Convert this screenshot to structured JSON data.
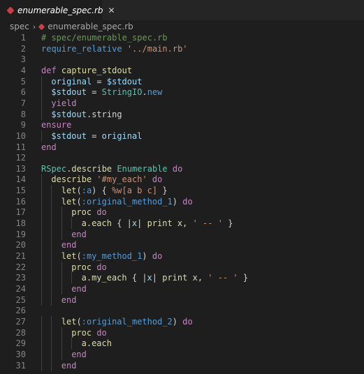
{
  "tab": {
    "label": "enumerable_spec.rb",
    "close": "✕"
  },
  "breadcrumb": {
    "folder": "spec",
    "separator": "›",
    "file": "enumerable_spec.rb"
  },
  "colors": {
    "background": "#1e1e1e",
    "ruby_icon": "#cc3e44"
  },
  "lines": [
    {
      "n": "1",
      "indent": 0,
      "tokens": [
        {
          "t": "# spec/enumerable_spec.rb",
          "c": "comment"
        }
      ]
    },
    {
      "n": "2",
      "indent": 0,
      "tokens": [
        {
          "t": "require_relative",
          "c": "sym"
        },
        {
          "t": " ",
          "c": "default"
        },
        {
          "t": "'../main.rb'",
          "c": "str"
        }
      ]
    },
    {
      "n": "3",
      "indent": 0,
      "tokens": []
    },
    {
      "n": "4",
      "indent": 0,
      "tokens": [
        {
          "t": "def",
          "c": "kw"
        },
        {
          "t": " ",
          "c": "default"
        },
        {
          "t": "capture_stdout",
          "c": "fn"
        }
      ]
    },
    {
      "n": "5",
      "indent": 1,
      "tokens": [
        {
          "t": "original",
          "c": "var"
        },
        {
          "t": " = ",
          "c": "default"
        },
        {
          "t": "$stdout",
          "c": "var"
        }
      ]
    },
    {
      "n": "6",
      "indent": 1,
      "tokens": [
        {
          "t": "$stdout",
          "c": "var"
        },
        {
          "t": " = ",
          "c": "default"
        },
        {
          "t": "StringIO",
          "c": "const"
        },
        {
          "t": ".",
          "c": "default"
        },
        {
          "t": "new",
          "c": "sym"
        }
      ]
    },
    {
      "n": "7",
      "indent": 1,
      "tokens": [
        {
          "t": "yield",
          "c": "kw"
        }
      ]
    },
    {
      "n": "8",
      "indent": 1,
      "tokens": [
        {
          "t": "$stdout",
          "c": "var"
        },
        {
          "t": ".string",
          "c": "default"
        }
      ]
    },
    {
      "n": "9",
      "indent": 0,
      "tokens": [
        {
          "t": "ensure",
          "c": "kw"
        }
      ]
    },
    {
      "n": "10",
      "indent": 1,
      "tokens": [
        {
          "t": "$stdout",
          "c": "var"
        },
        {
          "t": " = ",
          "c": "default"
        },
        {
          "t": "original",
          "c": "var"
        }
      ]
    },
    {
      "n": "11",
      "indent": 0,
      "tokens": [
        {
          "t": "end",
          "c": "kw"
        }
      ]
    },
    {
      "n": "12",
      "indent": 0,
      "tokens": []
    },
    {
      "n": "13",
      "indent": 0,
      "tokens": [
        {
          "t": "RSpec",
          "c": "const"
        },
        {
          "t": ".",
          "c": "default"
        },
        {
          "t": "describe",
          "c": "fn"
        },
        {
          "t": " ",
          "c": "default"
        },
        {
          "t": "Enumerable",
          "c": "const"
        },
        {
          "t": " ",
          "c": "default"
        },
        {
          "t": "do",
          "c": "kw"
        }
      ]
    },
    {
      "n": "14",
      "indent": 1,
      "tokens": [
        {
          "t": "describe",
          "c": "fn"
        },
        {
          "t": " ",
          "c": "default"
        },
        {
          "t": "'#my_each'",
          "c": "str"
        },
        {
          "t": " ",
          "c": "default"
        },
        {
          "t": "do",
          "c": "kw"
        }
      ]
    },
    {
      "n": "15",
      "indent": 2,
      "tokens": [
        {
          "t": "let",
          "c": "fn"
        },
        {
          "t": "(",
          "c": "default"
        },
        {
          "t": ":a",
          "c": "sym"
        },
        {
          "t": ") { ",
          "c": "default"
        },
        {
          "t": "%w[a b c]",
          "c": "str"
        },
        {
          "t": " }",
          "c": "default"
        }
      ]
    },
    {
      "n": "16",
      "indent": 2,
      "tokens": [
        {
          "t": "let",
          "c": "fn"
        },
        {
          "t": "(",
          "c": "default"
        },
        {
          "t": ":original_method_1",
          "c": "sym"
        },
        {
          "t": ") ",
          "c": "default"
        },
        {
          "t": "do",
          "c": "kw"
        }
      ]
    },
    {
      "n": "17",
      "indent": 3,
      "tokens": [
        {
          "t": "proc",
          "c": "fn"
        },
        {
          "t": " ",
          "c": "default"
        },
        {
          "t": "do",
          "c": "kw"
        }
      ]
    },
    {
      "n": "18",
      "indent": 4,
      "tokens": [
        {
          "t": "a",
          "c": "fn"
        },
        {
          "t": ".",
          "c": "default"
        },
        {
          "t": "each",
          "c": "fn"
        },
        {
          "t": " { |",
          "c": "default"
        },
        {
          "t": "x",
          "c": "var"
        },
        {
          "t": "| ",
          "c": "default"
        },
        {
          "t": "print",
          "c": "fn"
        },
        {
          "t": " ",
          "c": "default"
        },
        {
          "t": "x",
          "c": "fn"
        },
        {
          "t": ", ",
          "c": "default"
        },
        {
          "t": "' -- '",
          "c": "str"
        },
        {
          "t": " }",
          "c": "default"
        }
      ]
    },
    {
      "n": "19",
      "indent": 3,
      "tokens": [
        {
          "t": "end",
          "c": "kw"
        }
      ]
    },
    {
      "n": "20",
      "indent": 2,
      "tokens": [
        {
          "t": "end",
          "c": "kw"
        }
      ]
    },
    {
      "n": "21",
      "indent": 2,
      "tokens": [
        {
          "t": "let",
          "c": "fn"
        },
        {
          "t": "(",
          "c": "default"
        },
        {
          "t": ":my_method_1",
          "c": "sym"
        },
        {
          "t": ") ",
          "c": "default"
        },
        {
          "t": "do",
          "c": "kw"
        }
      ]
    },
    {
      "n": "22",
      "indent": 3,
      "tokens": [
        {
          "t": "proc",
          "c": "fn"
        },
        {
          "t": " ",
          "c": "default"
        },
        {
          "t": "do",
          "c": "kw"
        }
      ]
    },
    {
      "n": "23",
      "indent": 4,
      "tokens": [
        {
          "t": "a",
          "c": "fn"
        },
        {
          "t": ".",
          "c": "default"
        },
        {
          "t": "my_each",
          "c": "fn"
        },
        {
          "t": " { |",
          "c": "default"
        },
        {
          "t": "x",
          "c": "var"
        },
        {
          "t": "| ",
          "c": "default"
        },
        {
          "t": "print",
          "c": "fn"
        },
        {
          "t": " ",
          "c": "default"
        },
        {
          "t": "x",
          "c": "fn"
        },
        {
          "t": ", ",
          "c": "default"
        },
        {
          "t": "' -- '",
          "c": "str"
        },
        {
          "t": " }",
          "c": "default"
        }
      ]
    },
    {
      "n": "24",
      "indent": 3,
      "tokens": [
        {
          "t": "end",
          "c": "kw"
        }
      ]
    },
    {
      "n": "25",
      "indent": 2,
      "tokens": [
        {
          "t": "end",
          "c": "kw"
        }
      ]
    },
    {
      "n": "26",
      "indent": 0,
      "tokens": []
    },
    {
      "n": "27",
      "indent": 2,
      "tokens": [
        {
          "t": "let",
          "c": "fn"
        },
        {
          "t": "(",
          "c": "default"
        },
        {
          "t": ":original_method_2",
          "c": "sym"
        },
        {
          "t": ") ",
          "c": "default"
        },
        {
          "t": "do",
          "c": "kw"
        }
      ]
    },
    {
      "n": "28",
      "indent": 3,
      "tokens": [
        {
          "t": "proc",
          "c": "fn"
        },
        {
          "t": " ",
          "c": "default"
        },
        {
          "t": "do",
          "c": "kw"
        }
      ]
    },
    {
      "n": "29",
      "indent": 4,
      "tokens": [
        {
          "t": "a",
          "c": "fn"
        },
        {
          "t": ".",
          "c": "default"
        },
        {
          "t": "each",
          "c": "fn"
        }
      ]
    },
    {
      "n": "30",
      "indent": 3,
      "tokens": [
        {
          "t": "end",
          "c": "kw"
        }
      ]
    },
    {
      "n": "31",
      "indent": 2,
      "tokens": [
        {
          "t": "end",
          "c": "kw"
        }
      ]
    }
  ]
}
